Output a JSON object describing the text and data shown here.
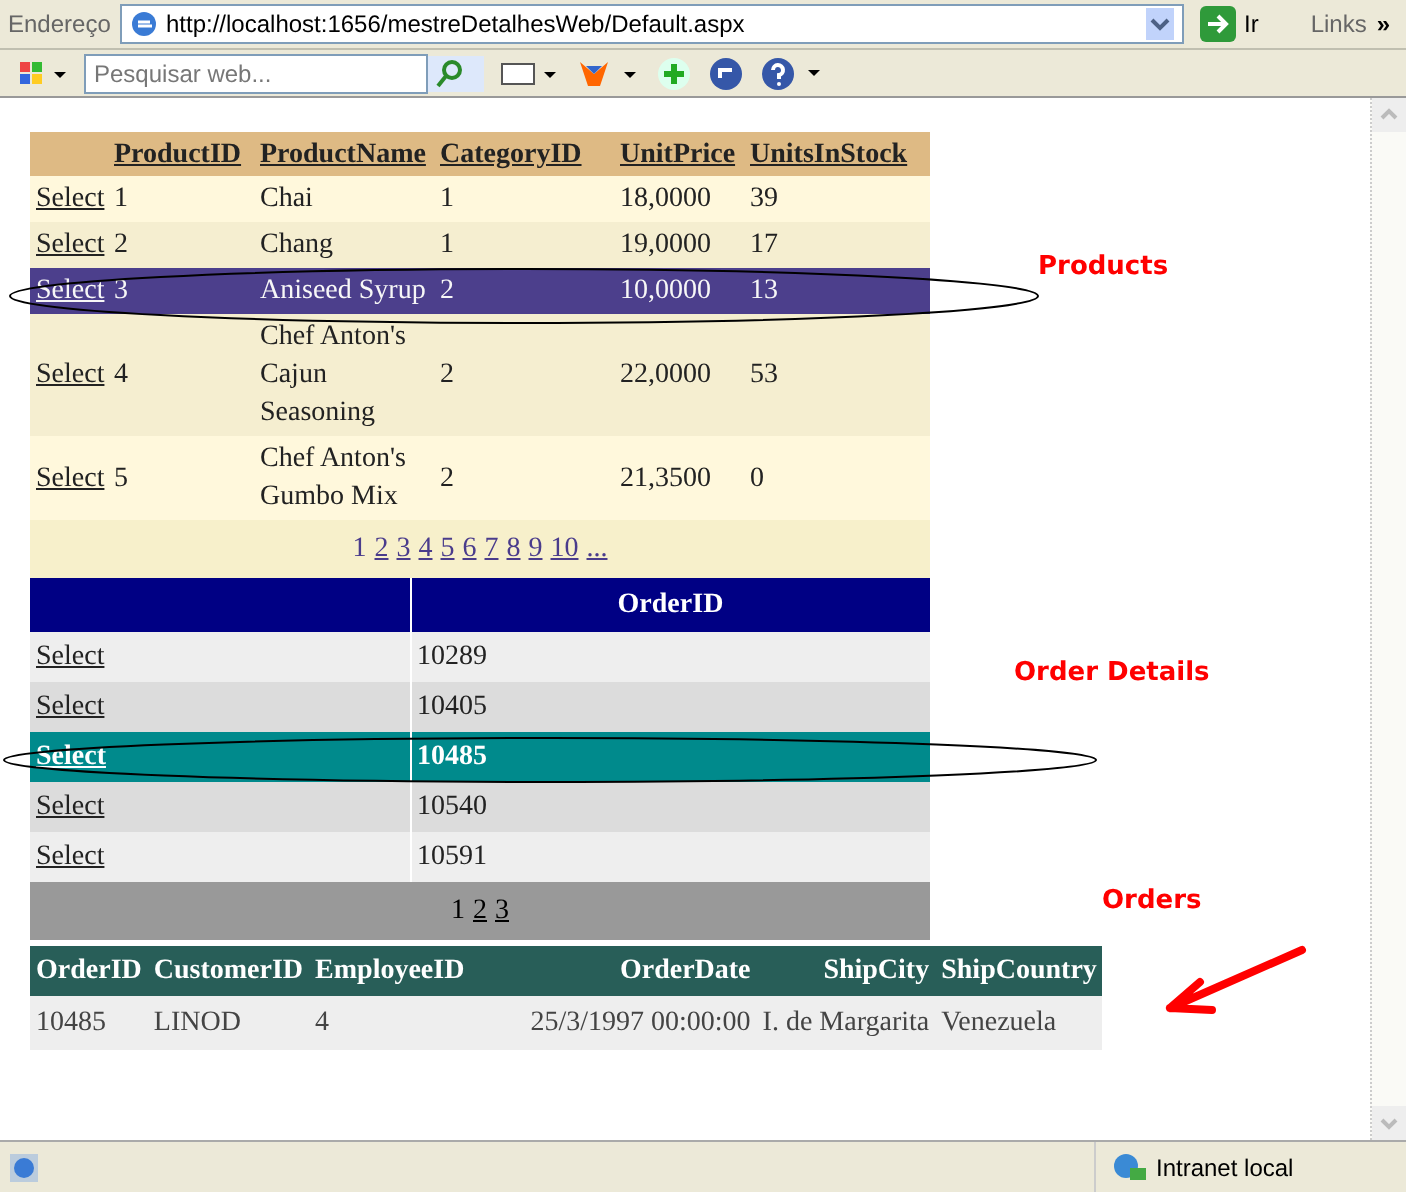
{
  "address_bar": {
    "label": "Endereço",
    "url": "http://localhost:1656/mestreDetalhesWeb/Default.aspx",
    "go": "Ir",
    "links": "Links",
    "more": "»"
  },
  "toolbar": {
    "search": {
      "placeholder": "Pesquisar web..."
    }
  },
  "products": {
    "columns": [
      "ProductID",
      "ProductName",
      "CategoryID",
      "UnitPrice",
      "UnitsInStock"
    ],
    "rows": [
      {
        "select": "Select",
        "cells": [
          "1",
          "Chai",
          "1",
          "18,0000",
          "39"
        ],
        "selected": false
      },
      {
        "select": "Select",
        "cells": [
          "2",
          "Chang",
          "1",
          "19,0000",
          "17"
        ],
        "selected": false
      },
      {
        "select": "Select",
        "cells": [
          "3",
          "Aniseed Syrup",
          "2",
          "10,0000",
          "13"
        ],
        "selected": true
      },
      {
        "select": "Select",
        "cells": [
          "4",
          "Chef Anton's Cajun Seasoning",
          "2",
          "22,0000",
          "53"
        ],
        "selected": false
      },
      {
        "select": "Select",
        "cells": [
          "5",
          "Chef Anton's Gumbo Mix",
          "2",
          "21,3500",
          "0"
        ],
        "selected": false
      }
    ],
    "pager": [
      {
        "label": "1",
        "selected": true
      },
      {
        "label": "2",
        "selected": false
      },
      {
        "label": "3",
        "selected": false
      },
      {
        "label": "4",
        "selected": false
      },
      {
        "label": "5",
        "selected": false
      },
      {
        "label": "6",
        "selected": false
      },
      {
        "label": "7",
        "selected": false
      },
      {
        "label": "8",
        "selected": false
      },
      {
        "label": "9",
        "selected": false
      },
      {
        "label": "10",
        "selected": false
      },
      {
        "label": "...",
        "selected": false
      }
    ]
  },
  "order_details": {
    "columns": [
      "OrderID"
    ],
    "rows": [
      {
        "select": "Select",
        "cells": [
          "10289"
        ],
        "selected": false
      },
      {
        "select": "Select",
        "cells": [
          "10405"
        ],
        "selected": false
      },
      {
        "select": "Select",
        "cells": [
          "10485"
        ],
        "selected": true
      },
      {
        "select": "Select",
        "cells": [
          "10540"
        ],
        "selected": false
      },
      {
        "select": "Select",
        "cells": [
          "10591"
        ],
        "selected": false
      }
    ],
    "pager": [
      {
        "label": "1",
        "selected": true
      },
      {
        "label": "2",
        "selected": false
      },
      {
        "label": "3",
        "selected": false
      }
    ]
  },
  "orders": {
    "columns": [
      "OrderID",
      "CustomerID",
      "EmployeeID",
      "OrderDate",
      "ShipCity",
      "ShipCountry"
    ],
    "rows": [
      {
        "cells": [
          "10485",
          "LINOD",
          "4",
          "25/3/1997 00:00:00",
          "I. de Margarita",
          "Venezuela"
        ]
      }
    ]
  },
  "annotations": [
    "Products",
    "Order Details",
    "Orders"
  ],
  "status_bar": {
    "zone": "Intranet local"
  }
}
